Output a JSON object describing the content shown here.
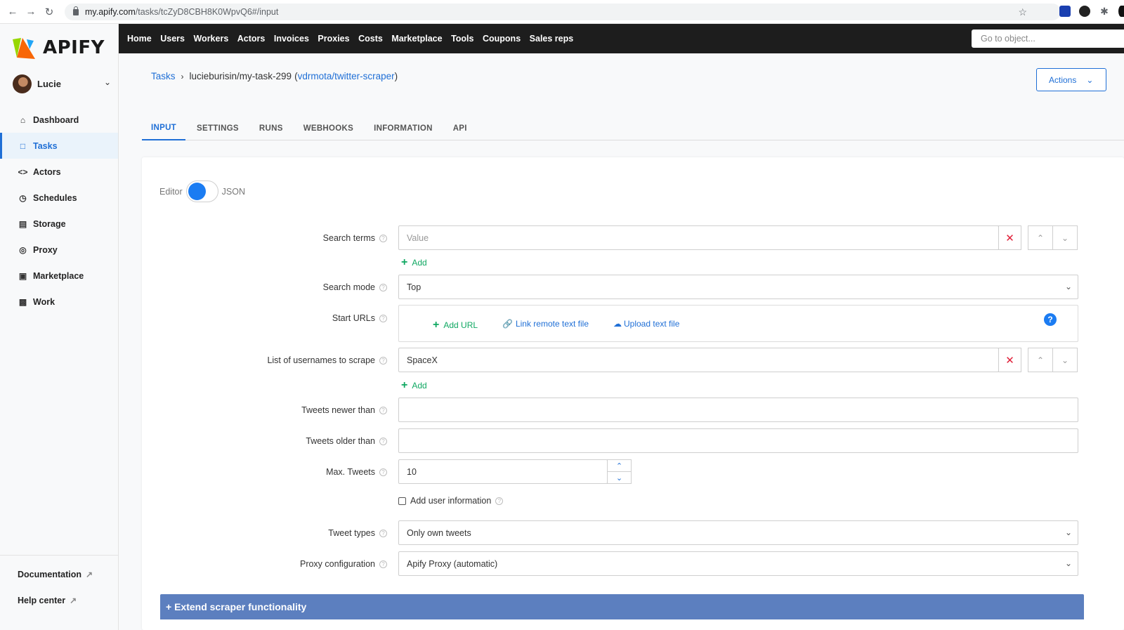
{
  "browser": {
    "url_host": "my.apify.com",
    "url_path": "/tasks/tcZyD8CBH8K0WpvQ6#/input"
  },
  "sidebar": {
    "logo_text": "APIFY",
    "user_name": "Lucie",
    "items": [
      {
        "label": "Dashboard",
        "icon": "home-icon"
      },
      {
        "label": "Tasks",
        "icon": "file-icon",
        "active": true
      },
      {
        "label": "Actors",
        "icon": "code-icon"
      },
      {
        "label": "Schedules",
        "icon": "clock-icon"
      },
      {
        "label": "Storage",
        "icon": "archive-icon"
      },
      {
        "label": "Proxy",
        "icon": "globe-icon"
      },
      {
        "label": "Marketplace",
        "icon": "store-icon"
      },
      {
        "label": "Work",
        "icon": "briefcase-icon"
      }
    ],
    "bottom_links": [
      {
        "label": "Documentation",
        "icon": "external-link-icon"
      },
      {
        "label": "Help center",
        "icon": "external-link-icon"
      }
    ]
  },
  "topbar": {
    "items": [
      "Home",
      "Users",
      "Workers",
      "Actors",
      "Invoices",
      "Proxies",
      "Costs",
      "Marketplace",
      "Tools",
      "Coupons",
      "Sales reps"
    ],
    "goto_placeholder": "Go to object..."
  },
  "breadcrumb": {
    "root": "Tasks",
    "task": "lucieburisin/my-task-299",
    "actor_open": "(",
    "actor": "vdrmota/twitter-scraper",
    "actor_close": ")"
  },
  "actions_label": "Actions",
  "tabs": [
    "INPUT",
    "SETTINGS",
    "RUNS",
    "WEBHOOKS",
    "INFORMATION",
    "API"
  ],
  "editor_toggle": {
    "left": "Editor",
    "right": "JSON"
  },
  "form": {
    "search_terms": {
      "label": "Search terms",
      "placeholder": "Value",
      "add": "Add"
    },
    "search_mode": {
      "label": "Search mode",
      "value": "Top"
    },
    "start_urls": {
      "label": "Start URLs",
      "add_url": "Add URL",
      "link_remote": "Link remote text file",
      "upload": "Upload text file"
    },
    "usernames": {
      "label": "List of usernames to scrape",
      "value": "SpaceX",
      "add": "Add"
    },
    "newer_than": {
      "label": "Tweets newer than",
      "value": ""
    },
    "older_than": {
      "label": "Tweets older than",
      "value": ""
    },
    "max_tweets": {
      "label": "Max. Tweets",
      "value": "10"
    },
    "add_user_info": {
      "label": "Add user information",
      "checked": false
    },
    "tweet_types": {
      "label": "Tweet types",
      "value": "Only own tweets"
    },
    "proxy_config": {
      "label": "Proxy configuration",
      "value": "Apify Proxy (automatic)"
    }
  },
  "extend_label": "+ Extend scraper functionality",
  "colors": {
    "accent": "#1f6fd6",
    "add_green": "#10a862",
    "delete_red": "#e0213a",
    "topbar": "#1d1d1d",
    "extend_bar": "#5c7fbf"
  }
}
